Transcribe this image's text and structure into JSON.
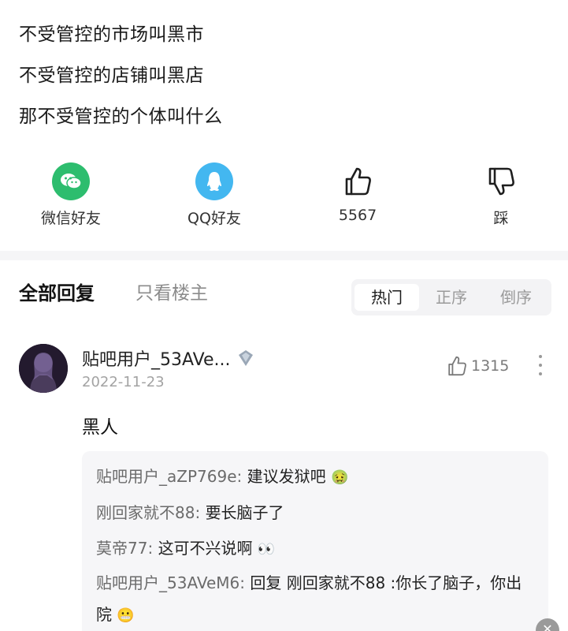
{
  "post": {
    "lines": [
      "不受管控的市场叫黑市",
      "不受管控的店铺叫黑店",
      "那不受管控的个体叫什么"
    ]
  },
  "share_bar": {
    "wechat_label": "微信好友",
    "qq_label": "QQ好友",
    "like_count": "5567",
    "dislike_label": "踩",
    "colors": {
      "wechat": "#2dbd6e",
      "qq": "#43b7f0"
    }
  },
  "replies_header": {
    "all_tab": "全部回复",
    "host_only_tab": "只看楼主",
    "sort_options": [
      "热门",
      "正序",
      "倒序"
    ],
    "active_sort": "热门"
  },
  "comment": {
    "username": "贴吧用户_53AVe...",
    "date": "2022-11-23",
    "likes": "1315",
    "text": "黑人",
    "sub_replies": [
      {
        "user": "贴吧用户_aZP769e",
        "text": "建议发狱吧",
        "emoji": "🤢"
      },
      {
        "user": "刚回家就不88",
        "text": "要长脑子了",
        "emoji": ""
      },
      {
        "user": "莫帝77",
        "text": "这可不兴说啊",
        "emoji": "👀"
      },
      {
        "user": "贴吧用户_53AVeM6",
        "text": "回复 刚回家就不88 :你长了脑子，你出院",
        "emoji": "😬"
      }
    ]
  }
}
